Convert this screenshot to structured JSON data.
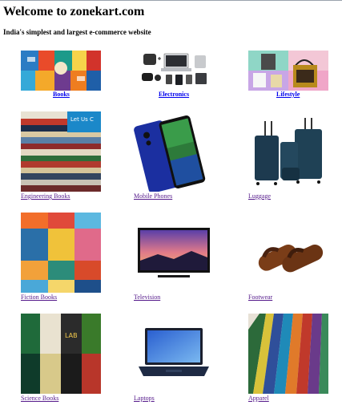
{
  "page": {
    "title": "Welcome to zonekart.com",
    "tagline": "India's simplest and largest e-commerce website"
  },
  "categories": [
    {
      "label": "Books",
      "icon": "books-icon"
    },
    {
      "label": "Electronics",
      "icon": "electronics-icon"
    },
    {
      "label": "Lifestyle",
      "icon": "lifestyle-icon"
    },
    {
      "label": "Engineering Books",
      "icon": "engineering-books-icon"
    },
    {
      "label": "Mobile Phones",
      "icon": "mobile-phone-icon"
    },
    {
      "label": "Luggage",
      "icon": "luggage-icon"
    },
    {
      "label": "Fiction Books",
      "icon": "fiction-books-icon"
    },
    {
      "label": "Television",
      "icon": "television-icon"
    },
    {
      "label": "Footwear",
      "icon": "footwear-icon"
    },
    {
      "label": "Science Books",
      "icon": "science-books-icon"
    },
    {
      "label": "Laptops",
      "icon": "laptop-icon"
    },
    {
      "label": "Apparel",
      "icon": "apparel-icon"
    }
  ],
  "colors": {
    "link": "#0000ee",
    "visited_link": "#551a8b",
    "rule": "#9aa3ad"
  }
}
